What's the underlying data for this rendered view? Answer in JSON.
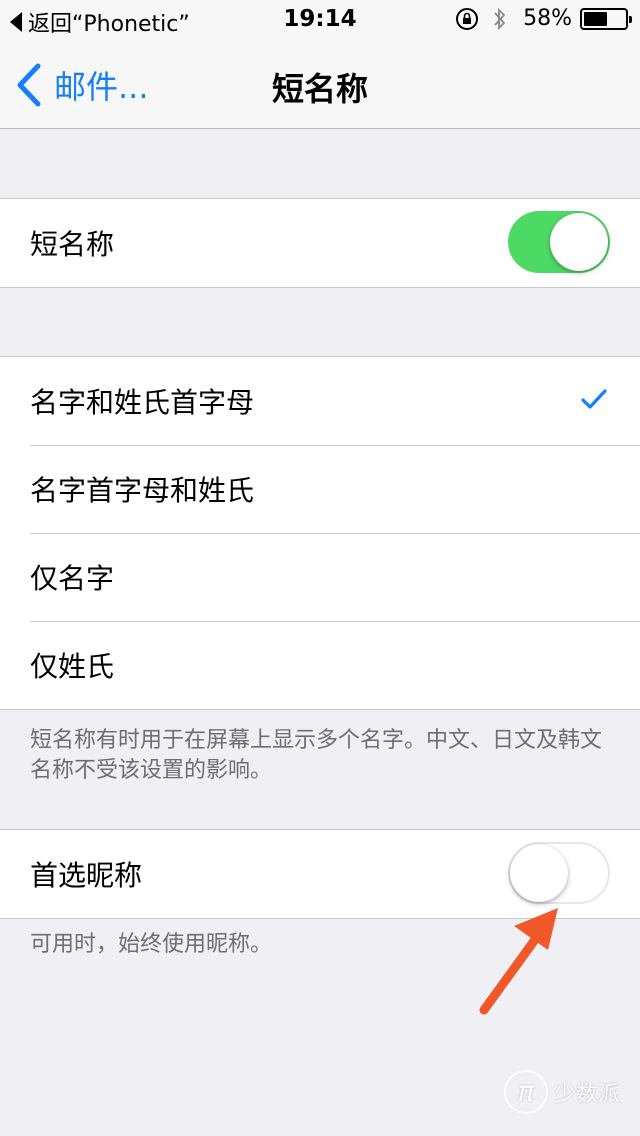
{
  "status_bar": {
    "back_app": "返回“Phonetic”",
    "time": "19:14",
    "battery_percent": "58%",
    "battery_level": 0.58
  },
  "nav": {
    "back_label": "邮件...",
    "title": "短名称"
  },
  "short_name": {
    "label": "短名称",
    "enabled": true
  },
  "format_options": [
    {
      "label": "名字和姓氏首字母",
      "selected": true
    },
    {
      "label": "名字首字母和姓氏",
      "selected": false
    },
    {
      "label": "仅名字",
      "selected": false
    },
    {
      "label": "仅姓氏",
      "selected": false
    }
  ],
  "format_footnote": "短名称有时用于在屏幕上显示多个名字。中文、日文及韩文名称不受该设置的影响。",
  "nickname": {
    "label": "首选昵称",
    "enabled": false
  },
  "nickname_footnote": "可用时，始终使用昵称。",
  "watermark": {
    "glyph": "π",
    "text": "少数派"
  },
  "colors": {
    "accent": "#157efb",
    "toggle_on": "#4cd964",
    "arrow": "#f0582a"
  }
}
